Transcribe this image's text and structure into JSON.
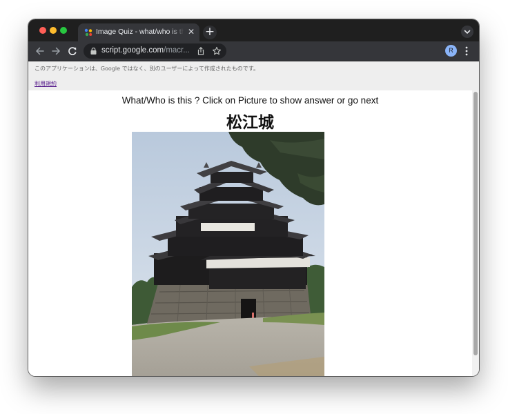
{
  "colors": {
    "close": "#ff5f57",
    "minimize": "#febc2e",
    "maximize": "#28c840",
    "tab_active_bg": "#35363a",
    "tabstrip_bg": "#1f1f1f",
    "omnibox_bg": "#202124",
    "link": "#551a8b"
  },
  "browser": {
    "tab": {
      "title": "Image Quiz - what/who is this?",
      "favicon": "apps-script-icon",
      "close_glyph": "✕"
    },
    "new_tab_glyph": "+",
    "omnibox": {
      "host": "script.google.com",
      "path": "/macr..."
    },
    "profile_initial": "R"
  },
  "banner": {
    "notice": "このアプリケーションは、Google ではなく、別のユーザーによって作成されたものです。",
    "terms_link": "利用規約"
  },
  "quiz": {
    "instruction": "What/Who is this ? Click on Picture to show answer or go next",
    "answer": "松江城",
    "picture_subject": "Matsue Castle"
  }
}
